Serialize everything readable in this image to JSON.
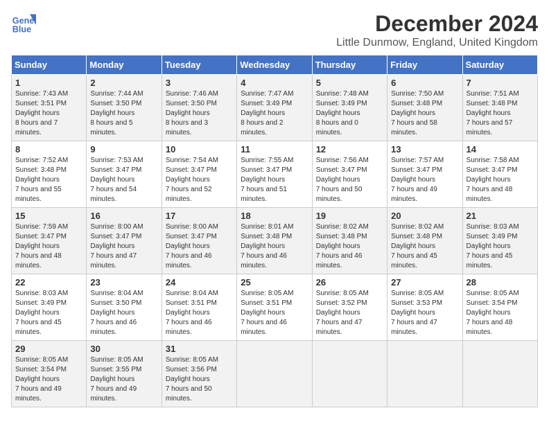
{
  "logo": {
    "line1": "General",
    "line2": "Blue"
  },
  "title": "December 2024",
  "subtitle": "Little Dunmow, England, United Kingdom",
  "headers": [
    "Sunday",
    "Monday",
    "Tuesday",
    "Wednesday",
    "Thursday",
    "Friday",
    "Saturday"
  ],
  "weeks": [
    [
      {
        "day": "1",
        "sunrise": "7:43 AM",
        "sunset": "3:51 PM",
        "daylight": "8 hours and 7 minutes."
      },
      {
        "day": "2",
        "sunrise": "7:44 AM",
        "sunset": "3:50 PM",
        "daylight": "8 hours and 5 minutes."
      },
      {
        "day": "3",
        "sunrise": "7:46 AM",
        "sunset": "3:50 PM",
        "daylight": "8 hours and 3 minutes."
      },
      {
        "day": "4",
        "sunrise": "7:47 AM",
        "sunset": "3:49 PM",
        "daylight": "8 hours and 2 minutes."
      },
      {
        "day": "5",
        "sunrise": "7:48 AM",
        "sunset": "3:49 PM",
        "daylight": "8 hours and 0 minutes."
      },
      {
        "day": "6",
        "sunrise": "7:50 AM",
        "sunset": "3:48 PM",
        "daylight": "7 hours and 58 minutes."
      },
      {
        "day": "7",
        "sunrise": "7:51 AM",
        "sunset": "3:48 PM",
        "daylight": "7 hours and 57 minutes."
      }
    ],
    [
      {
        "day": "8",
        "sunrise": "7:52 AM",
        "sunset": "3:48 PM",
        "daylight": "7 hours and 55 minutes."
      },
      {
        "day": "9",
        "sunrise": "7:53 AM",
        "sunset": "3:47 PM",
        "daylight": "7 hours and 54 minutes."
      },
      {
        "day": "10",
        "sunrise": "7:54 AM",
        "sunset": "3:47 PM",
        "daylight": "7 hours and 52 minutes."
      },
      {
        "day": "11",
        "sunrise": "7:55 AM",
        "sunset": "3:47 PM",
        "daylight": "7 hours and 51 minutes."
      },
      {
        "day": "12",
        "sunrise": "7:56 AM",
        "sunset": "3:47 PM",
        "daylight": "7 hours and 50 minutes."
      },
      {
        "day": "13",
        "sunrise": "7:57 AM",
        "sunset": "3:47 PM",
        "daylight": "7 hours and 49 minutes."
      },
      {
        "day": "14",
        "sunrise": "7:58 AM",
        "sunset": "3:47 PM",
        "daylight": "7 hours and 48 minutes."
      }
    ],
    [
      {
        "day": "15",
        "sunrise": "7:59 AM",
        "sunset": "3:47 PM",
        "daylight": "7 hours and 48 minutes."
      },
      {
        "day": "16",
        "sunrise": "8:00 AM",
        "sunset": "3:47 PM",
        "daylight": "7 hours and 47 minutes."
      },
      {
        "day": "17",
        "sunrise": "8:00 AM",
        "sunset": "3:47 PM",
        "daylight": "7 hours and 46 minutes."
      },
      {
        "day": "18",
        "sunrise": "8:01 AM",
        "sunset": "3:48 PM",
        "daylight": "7 hours and 46 minutes."
      },
      {
        "day": "19",
        "sunrise": "8:02 AM",
        "sunset": "3:48 PM",
        "daylight": "7 hours and 46 minutes."
      },
      {
        "day": "20",
        "sunrise": "8:02 AM",
        "sunset": "3:48 PM",
        "daylight": "7 hours and 45 minutes."
      },
      {
        "day": "21",
        "sunrise": "8:03 AM",
        "sunset": "3:49 PM",
        "daylight": "7 hours and 45 minutes."
      }
    ],
    [
      {
        "day": "22",
        "sunrise": "8:03 AM",
        "sunset": "3:49 PM",
        "daylight": "7 hours and 45 minutes."
      },
      {
        "day": "23",
        "sunrise": "8:04 AM",
        "sunset": "3:50 PM",
        "daylight": "7 hours and 46 minutes."
      },
      {
        "day": "24",
        "sunrise": "8:04 AM",
        "sunset": "3:51 PM",
        "daylight": "7 hours and 46 minutes."
      },
      {
        "day": "25",
        "sunrise": "8:05 AM",
        "sunset": "3:51 PM",
        "daylight": "7 hours and 46 minutes."
      },
      {
        "day": "26",
        "sunrise": "8:05 AM",
        "sunset": "3:52 PM",
        "daylight": "7 hours and 47 minutes."
      },
      {
        "day": "27",
        "sunrise": "8:05 AM",
        "sunset": "3:53 PM",
        "daylight": "7 hours and 47 minutes."
      },
      {
        "day": "28",
        "sunrise": "8:05 AM",
        "sunset": "3:54 PM",
        "daylight": "7 hours and 48 minutes."
      }
    ],
    [
      {
        "day": "29",
        "sunrise": "8:05 AM",
        "sunset": "3:54 PM",
        "daylight": "7 hours and 49 minutes."
      },
      {
        "day": "30",
        "sunrise": "8:05 AM",
        "sunset": "3:55 PM",
        "daylight": "7 hours and 49 minutes."
      },
      {
        "day": "31",
        "sunrise": "8:05 AM",
        "sunset": "3:56 PM",
        "daylight": "7 hours and 50 minutes."
      },
      null,
      null,
      null,
      null
    ]
  ]
}
